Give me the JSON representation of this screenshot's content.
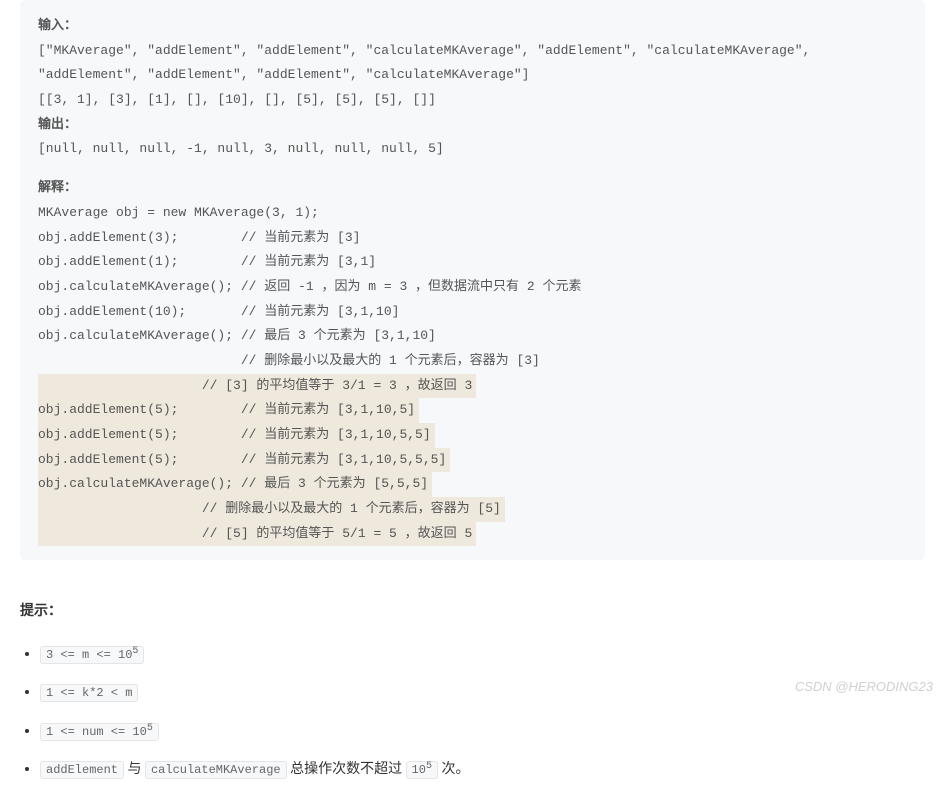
{
  "code": {
    "inputLabel": "输入：",
    "inputLine1": "[\"MKAverage\", \"addElement\", \"addElement\", \"calculateMKAverage\", \"addElement\", \"calculateMKAverage\",",
    "inputLine2": "\"addElement\", \"addElement\", \"addElement\", \"calculateMKAverage\"]",
    "inputLine3": "[[3, 1], [3], [1], [], [10], [], [5], [5], [5], []]",
    "outputLabel": "输出：",
    "outputLine": "[null, null, null, -1, null, 3, null, null, null, 5]",
    "explainLabel": "解释：",
    "explainLines": [
      "MKAverage obj = new MKAverage(3, 1);",
      "obj.addElement(3);        // 当前元素为 [3]",
      "obj.addElement(1);        // 当前元素为 [3,1]",
      "obj.calculateMKAverage(); // 返回 -1 ，因为 m = 3 ，但数据流中只有 2 个元素",
      "obj.addElement(10);       // 当前元素为 [3,1,10]",
      "obj.calculateMKAverage(); // 最后 3 个元素为 [3,1,10]",
      "                          // 删除最小以及最大的 1 个元素后，容器为 [3]"
    ],
    "highlightLines": [
      "                     // [3] 的平均值等于 3/1 = 3 ，故返回 3",
      "obj.addElement(5);        // 当前元素为 [3,1,10,5]",
      "obj.addElement(5);        // 当前元素为 [3,1,10,5,5]",
      "obj.addElement(5);        // 当前元素为 [3,1,10,5,5,5]",
      "obj.calculateMKAverage(); // 最后 3 个元素为 [5,5,5]",
      "                     // 删除最小以及最大的 1 个元素后，容器为 [5]",
      "                     // [5] 的平均值等于 5/1 = 5 ，故返回 5"
    ]
  },
  "hints": {
    "title": "提示：",
    "items": [
      {
        "pre": "3 <= m <= 10",
        "sup": "5",
        "post": ""
      },
      {
        "pre": "1 <= k*2 < m",
        "sup": "",
        "post": ""
      },
      {
        "pre": "1 <= num <= 10",
        "sup": "5",
        "post": ""
      }
    ],
    "lastItem": {
      "code1": "addElement",
      "joiner": " 与 ",
      "code2": "calculateMKAverage",
      "text1": " 总操作次数不超过 ",
      "codeNum": "10",
      "codeSup": "5",
      "text2": " 次。"
    }
  },
  "watermark": "CSDN @HERODING23"
}
